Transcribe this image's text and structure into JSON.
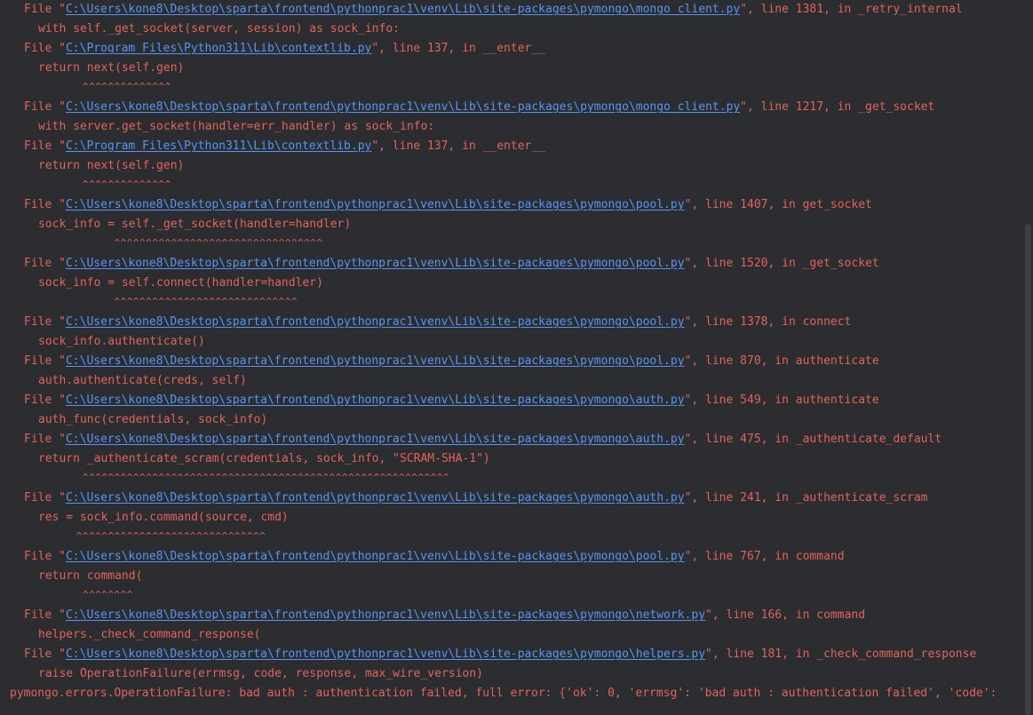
{
  "colors": {
    "background": "#2b2d30",
    "error_text": "#e5625a",
    "link": "#5894f5"
  },
  "traceback": [
    {
      "kind": "file",
      "pre": "File \"",
      "path": "C:\\Users\\kone8\\Desktop\\sparta\\frontend\\pythonprac1\\venv\\Lib\\site-packages\\pymongo\\mongo_client.py",
      "post": "\", line 1381, in _retry_internal"
    },
    {
      "kind": "code",
      "text": "with self._get_socket(server, session) as sock_info:"
    },
    {
      "kind": "file",
      "pre": "File \"",
      "path": "C:\\Program Files\\Python311\\Lib\\contextlib.py",
      "post": "\", line 137, in __enter__"
    },
    {
      "kind": "code",
      "text": "return next(self.gen)"
    },
    {
      "kind": "caret",
      "text": "       ^^^^^^^^^^^^^^"
    },
    {
      "kind": "file",
      "pre": "File \"",
      "path": "C:\\Users\\kone8\\Desktop\\sparta\\frontend\\pythonprac1\\venv\\Lib\\site-packages\\pymongo\\mongo_client.py",
      "post": "\", line 1217, in _get_socket"
    },
    {
      "kind": "code",
      "text": "with server.get_socket(handler=err_handler) as sock_info:"
    },
    {
      "kind": "file",
      "pre": "File \"",
      "path": "C:\\Program Files\\Python311\\Lib\\contextlib.py",
      "post": "\", line 137, in __enter__"
    },
    {
      "kind": "code",
      "text": "return next(self.gen)"
    },
    {
      "kind": "caret",
      "text": "       ^^^^^^^^^^^^^^"
    },
    {
      "kind": "file",
      "pre": "File \"",
      "path": "C:\\Users\\kone8\\Desktop\\sparta\\frontend\\pythonprac1\\venv\\Lib\\site-packages\\pymongo\\pool.py",
      "post": "\", line 1407, in get_socket"
    },
    {
      "kind": "code",
      "text": "sock_info = self._get_socket(handler=handler)"
    },
    {
      "kind": "caret",
      "text": "            ^^^^^^^^^^^^^^^^^^^^^^^^^^^^^^^^^"
    },
    {
      "kind": "file",
      "pre": "File \"",
      "path": "C:\\Users\\kone8\\Desktop\\sparta\\frontend\\pythonprac1\\venv\\Lib\\site-packages\\pymongo\\pool.py",
      "post": "\", line 1520, in _get_socket"
    },
    {
      "kind": "code",
      "text": "sock_info = self.connect(handler=handler)"
    },
    {
      "kind": "caret",
      "text": "            ^^^^^^^^^^^^^^^^^^^^^^^^^^^^^"
    },
    {
      "kind": "file",
      "pre": "File \"",
      "path": "C:\\Users\\kone8\\Desktop\\sparta\\frontend\\pythonprac1\\venv\\Lib\\site-packages\\pymongo\\pool.py",
      "post": "\", line 1378, in connect"
    },
    {
      "kind": "code",
      "text": "sock_info.authenticate()"
    },
    {
      "kind": "file",
      "pre": "File \"",
      "path": "C:\\Users\\kone8\\Desktop\\sparta\\frontend\\pythonprac1\\venv\\Lib\\site-packages\\pymongo\\pool.py",
      "post": "\", line 870, in authenticate"
    },
    {
      "kind": "code",
      "text": "auth.authenticate(creds, self)"
    },
    {
      "kind": "file",
      "pre": "File \"",
      "path": "C:\\Users\\kone8\\Desktop\\sparta\\frontend\\pythonprac1\\venv\\Lib\\site-packages\\pymongo\\auth.py",
      "post": "\", line 549, in authenticate"
    },
    {
      "kind": "code",
      "text": "auth_func(credentials, sock_info)"
    },
    {
      "kind": "file",
      "pre": "File \"",
      "path": "C:\\Users\\kone8\\Desktop\\sparta\\frontend\\pythonprac1\\venv\\Lib\\site-packages\\pymongo\\auth.py",
      "post": "\", line 475, in _authenticate_default"
    },
    {
      "kind": "code",
      "text": "return _authenticate_scram(credentials, sock_info, \"SCRAM-SHA-1\")"
    },
    {
      "kind": "caret",
      "text": "       ^^^^^^^^^^^^^^^^^^^^^^^^^^^^^^^^^^^^^^^^^^^^^^^^^^^^^^^^^^"
    },
    {
      "kind": "file",
      "pre": "File \"",
      "path": "C:\\Users\\kone8\\Desktop\\sparta\\frontend\\pythonprac1\\venv\\Lib\\site-packages\\pymongo\\auth.py",
      "post": "\", line 241, in _authenticate_scram"
    },
    {
      "kind": "code",
      "text": "res = sock_info.command(source, cmd)"
    },
    {
      "kind": "caret",
      "text": "      ^^^^^^^^^^^^^^^^^^^^^^^^^^^^^^"
    },
    {
      "kind": "file",
      "pre": "File \"",
      "path": "C:\\Users\\kone8\\Desktop\\sparta\\frontend\\pythonprac1\\venv\\Lib\\site-packages\\pymongo\\pool.py",
      "post": "\", line 767, in command"
    },
    {
      "kind": "code",
      "text": "return command("
    },
    {
      "kind": "caret",
      "text": "       ^^^^^^^^"
    },
    {
      "kind": "file",
      "pre": "File \"",
      "path": "C:\\Users\\kone8\\Desktop\\sparta\\frontend\\pythonprac1\\venv\\Lib\\site-packages\\pymongo\\network.py",
      "post": "\", line 166, in command"
    },
    {
      "kind": "code",
      "text": "helpers._check_command_response("
    },
    {
      "kind": "file",
      "pre": "File \"",
      "path": "C:\\Users\\kone8\\Desktop\\sparta\\frontend\\pythonprac1\\venv\\Lib\\site-packages\\pymongo\\helpers.py",
      "post": "\", line 181, in _check_command_response"
    },
    {
      "kind": "code",
      "text": "raise OperationFailure(errmsg, code, response, max_wire_version)"
    },
    {
      "kind": "final",
      "text": "pymongo.errors.OperationFailure: bad auth : authentication failed, full error: {'ok': 0, 'errmsg': 'bad auth : authentication failed', 'code':"
    }
  ]
}
